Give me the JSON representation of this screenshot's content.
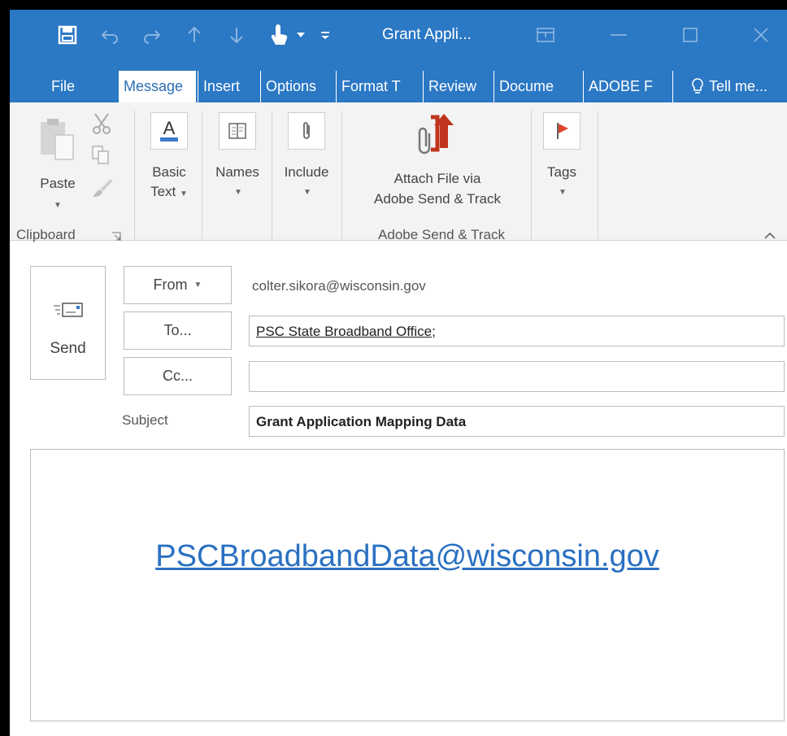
{
  "window": {
    "title": "Grant Appli..."
  },
  "tabs": [
    {
      "label": "File"
    },
    {
      "label": "Message"
    },
    {
      "label": "Insert"
    },
    {
      "label": "Options"
    },
    {
      "label": "Format T"
    },
    {
      "label": "Review"
    },
    {
      "label": "Docume"
    },
    {
      "label": "ADOBE F"
    },
    {
      "label": "Tell me..."
    }
  ],
  "ribbon": {
    "paste_label": "Paste",
    "clipboard_group": "Clipboard",
    "basic_text_line1": "Basic",
    "basic_text_line2": "Text",
    "names_label": "Names",
    "include_label": "Include",
    "attach_line1": "Attach File via",
    "attach_line2": "Adobe Send & Track",
    "adobe_group": "Adobe Send & Track",
    "tags_label": "Tags"
  },
  "compose": {
    "send_label": "Send",
    "from_label": "From",
    "from_address": "colter.sikora@wisconsin.gov",
    "to_label": "To...",
    "to_value": "PSC State Broadband Office",
    "to_separator": ";",
    "cc_label": "Cc...",
    "cc_value": "",
    "subject_label": "Subject",
    "subject_value": "Grant Application Mapping Data"
  },
  "body": {
    "link_text": "PSCBroadbandData@wisconsin.gov"
  },
  "colors": {
    "accent": "#2b78c5",
    "link": "#2a70c2",
    "flag": "#e0442b",
    "adobe_red": "#c0341d"
  }
}
